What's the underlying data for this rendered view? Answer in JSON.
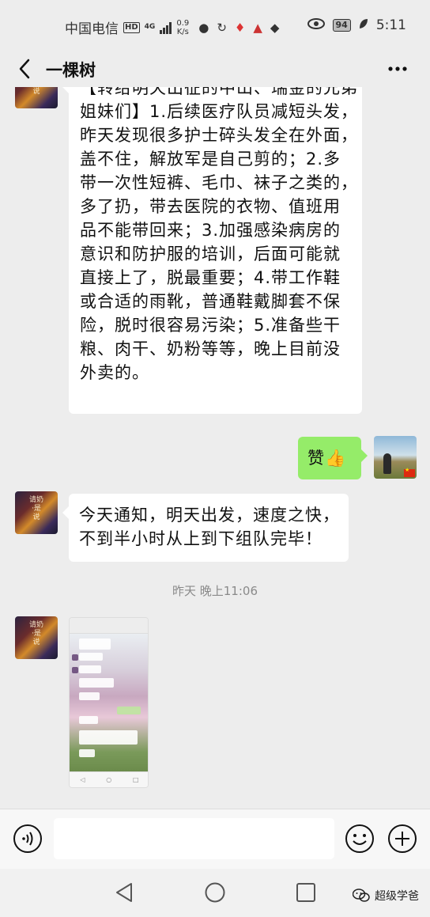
{
  "status_bar": {
    "carrier": "中国电信",
    "hd_badge": "HD",
    "network_type": "4G",
    "network_speed_value": "0.9",
    "network_speed_unit": "K/s",
    "battery": "94",
    "time": "5:11"
  },
  "header": {
    "title": "一棵树"
  },
  "messages": {
    "long_message_lines": [
      "【转给明天出征的中山、瑞金的兄弟",
      "姐妹们】1.后续医疗队员减短头发，",
      "昨天发现很多护士碎头发全在外面，",
      "盖不住，解放军是自己剪的；2.多",
      "带一次性短裤、毛巾、袜子之类的，",
      "多了扔，带去医院的衣物、值班用",
      "品不能带回来；3.加强感染病房的",
      "意识和防护服的培训，后面可能就",
      "直接上了，脱最重要；4.带工作鞋",
      "或合适的雨靴，普通鞋戴脚套不保",
      "险，脱时很容易污染；5.准备些干",
      "粮、肉干、奶粉等等，晚上目前没",
      "外卖的。"
    ],
    "reply_text": "赞👍",
    "second_message_lines": [
      "今天通知，明天出发，速度之快，",
      "不到半小时从上到下组队完毕！"
    ],
    "timestamp": "昨天 晚上11:06",
    "avatar_caption": "请奶·是说"
  },
  "input_bar": {
    "placeholder": ""
  },
  "watermark": {
    "text": "超级学爸"
  },
  "icons": {
    "back": "back-chevron-icon",
    "more": "more-dots-icon",
    "voice": "voice-icon",
    "emoji": "emoji-icon",
    "plus": "plus-icon"
  },
  "colors": {
    "background": "#ededed",
    "sent_bubble": "#95ec69",
    "received_bubble": "#ffffff"
  }
}
